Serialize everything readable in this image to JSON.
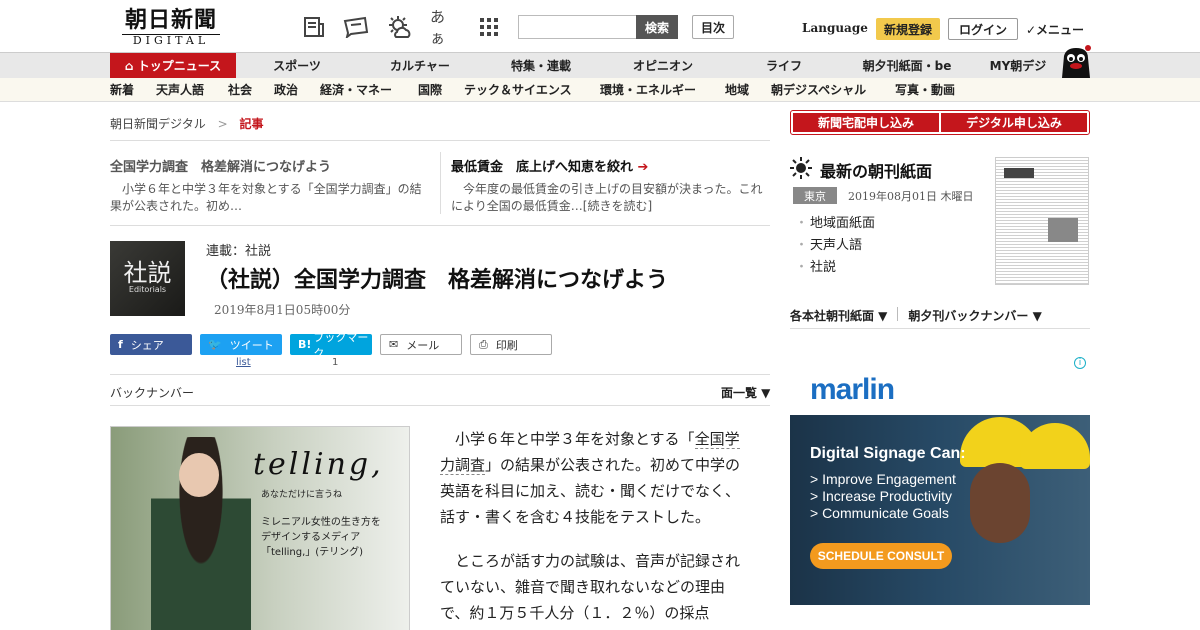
{
  "header": {
    "logo_main": "朝日新聞",
    "logo_sub": "DIGITAL",
    "search_button": "検索",
    "index_button": "目次",
    "language": "Language",
    "register": "新規登録",
    "login": "ログイン",
    "menu": "✓メニュー",
    "font_size_icon_label": "あぁ"
  },
  "nav_main": [
    "トップニュース",
    "スポーツ",
    "カルチャー",
    "特集・連載",
    "オピニオン",
    "ライフ",
    "朝夕刊紙面・be",
    "MY朝デジ"
  ],
  "nav_sub": [
    "新着",
    "天声人語",
    "社会",
    "政治",
    "経済・マネー",
    "国際",
    "テック＆サイエンス",
    "環境・エネルギー",
    "地域",
    "朝デジスペシャル",
    "写真・動画"
  ],
  "breadcrumb": {
    "home": "朝日新聞デジタル",
    "sep": ">",
    "current": "記事"
  },
  "related": [
    {
      "title": "全国学力調査　格差解消につなげよう",
      "body": "小学６年と中学３年を対象とする「全国学力調査」の結果が公表された。初め…"
    },
    {
      "title": "最低賃金　底上げへ知恵を絞れ",
      "body": "今年度の最低賃金の引き上げの目安額が決まった。これにより全国の最低賃金…[続きを読む]"
    }
  ],
  "article": {
    "series": "連載：社説",
    "title": "（社説）全国学力調査　格差解消につなげよう",
    "date": "2019年8月1日05時00分",
    "editorial_kanji": "社説",
    "editorial_en": "Editorials",
    "body_p1_a": "小学６年と中学３年を対象とする「",
    "body_p1_kw": "全国学力調査",
    "body_p1_b": "」の結果が公表された。初めて中学の英語を科目に加え、読む・聞くだけでなく、話す・書くを含む４技能をテストした。",
    "body_p2": "ところが話す力の試験は、音声が記録されていない、雑音で聞き取れないなどの理由で、約１万５千人分（１．２％）の採点"
  },
  "share": {
    "facebook": "シェア",
    "twitter": "ツイート",
    "hatena": "ブックマーク",
    "hatena_logo": "B!",
    "mail": "メール",
    "print": "印刷",
    "twitter_count": "list",
    "hatena_count": "1"
  },
  "backnumber": "バックナンバー",
  "menu_list": "面一覧 ▼",
  "ad_left": {
    "brand": "telling,",
    "tagline": "あなただけに言うね",
    "copy": "ミレニアル女性の生き方を\nデザインするメディア\n「telling,」(テリング)"
  },
  "sidebar": {
    "sub_newspaper": "新聞宅配申し込み",
    "sub_digital": "デジタル申し込み",
    "paper_title": "最新の朝刊紙面",
    "location": "東京",
    "paper_date": "2019年08月01日 木曜日",
    "paper_items": [
      "地域面紙面",
      "天声人語",
      "社説"
    ],
    "link_morning": "各本社朝刊紙面 ▼",
    "link_backnum": "朝夕刊バックナンバー ▼"
  },
  "ad_right": {
    "logo": "marlin",
    "headline": "Digital Signage Can:",
    "bullets": [
      "> Improve Engagement",
      "> Increase Productivity",
      "> Communicate Goals"
    ],
    "cta": "SCHEDULE CONSULT"
  },
  "colors": {
    "brand_red": "#c4161c",
    "register_yellow": "#f2c94c",
    "ad_teal": "#1bb0c8"
  }
}
